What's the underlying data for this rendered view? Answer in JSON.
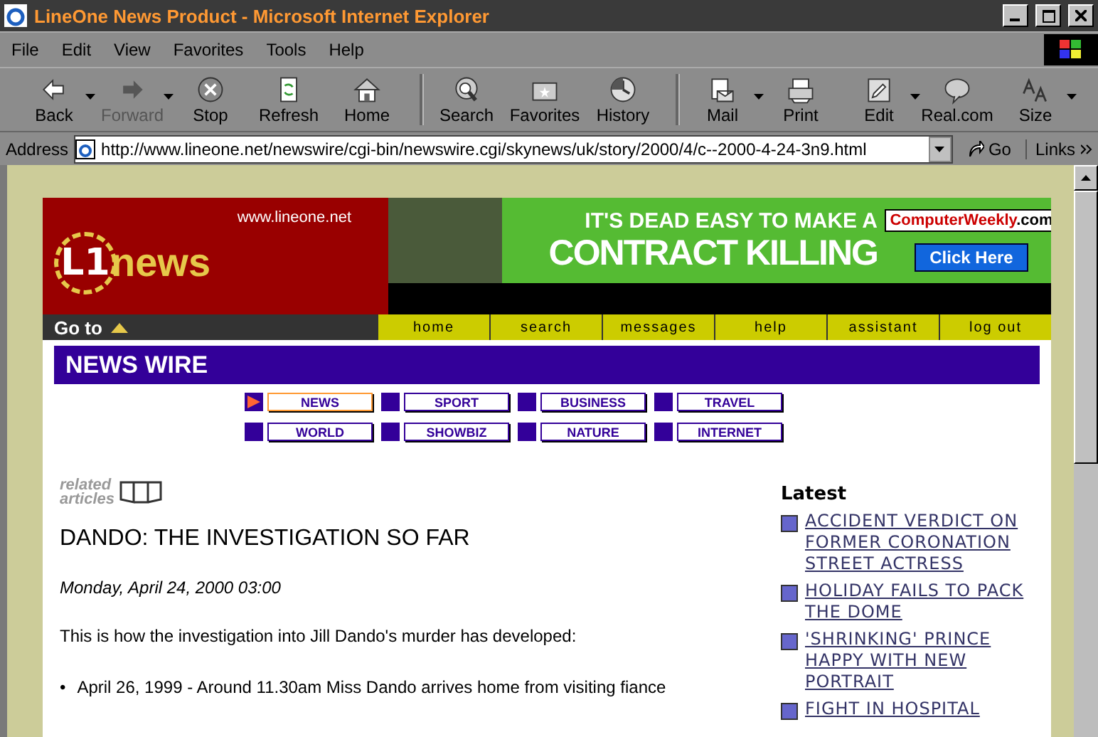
{
  "window": {
    "title": "LineOne News Product - Microsoft Internet Explorer"
  },
  "menu": [
    "File",
    "Edit",
    "View",
    "Favorites",
    "Tools",
    "Help"
  ],
  "toolbar": [
    {
      "label": "Back",
      "dropdown": true,
      "disabled": false
    },
    {
      "label": "Forward",
      "dropdown": true,
      "disabled": true
    },
    {
      "label": "Stop",
      "dropdown": false,
      "disabled": false
    },
    {
      "label": "Refresh",
      "dropdown": false,
      "disabled": false
    },
    {
      "label": "Home",
      "dropdown": false,
      "disabled": false
    },
    {
      "label": "Search",
      "dropdown": false,
      "disabled": false
    },
    {
      "label": "Favorites",
      "dropdown": false,
      "disabled": false
    },
    {
      "label": "History",
      "dropdown": false,
      "disabled": false
    },
    {
      "label": "Mail",
      "dropdown": true,
      "disabled": false
    },
    {
      "label": "Print",
      "dropdown": false,
      "disabled": false
    },
    {
      "label": "Edit",
      "dropdown": true,
      "disabled": false
    },
    {
      "label": "Real.com",
      "dropdown": false,
      "disabled": false
    },
    {
      "label": "Size",
      "dropdown": true,
      "disabled": false
    }
  ],
  "address_bar": {
    "label": "Address",
    "url": "http://www.lineone.net/newswire/cgi-bin/newswire.cgi/skynews/uk/story/2000/4/c--2000-4-24-3n9.html",
    "go": "Go",
    "links": "Links"
  },
  "header": {
    "site_url": "www.lineone.net",
    "logo_mark": "L1",
    "logo_word": "news",
    "goto": "Go to"
  },
  "ad": {
    "tagline": "IT'S DEAD EASY TO MAKE A",
    "headline": "CONTRACT KILLING",
    "brand": "ComputerWeekly",
    "brand_suffix": ".com",
    "cta": "Click Here"
  },
  "nav": [
    "home",
    "search",
    "messages",
    "help",
    "assistant",
    "log out"
  ],
  "section_title": "NEWS WIRE",
  "categories": [
    {
      "label": "NEWS",
      "selected": true
    },
    {
      "label": "SPORT",
      "selected": false
    },
    {
      "label": "BUSINESS",
      "selected": false
    },
    {
      "label": "TRAVEL",
      "selected": false
    },
    {
      "label": "WORLD",
      "selected": false
    },
    {
      "label": "SHOWBIZ",
      "selected": false
    },
    {
      "label": "NATURE",
      "selected": false
    },
    {
      "label": "INTERNET",
      "selected": false
    }
  ],
  "related": [
    "related",
    "articles"
  ],
  "article": {
    "headline": "DANDO: THE INVESTIGATION SO FAR",
    "date": "Monday, April 24, 2000 03:00",
    "intro": "This is how the investigation into Jill Dando's murder has developed:",
    "bullets": [
      {
        "marker": "•",
        "text": "April 26, 1999 - Around 11.30am Miss Dando arrives home from visiting fiance"
      }
    ]
  },
  "latest": {
    "title": "Latest",
    "items": [
      "ACCIDENT VERDICT ON FORMER CORONATION STREET ACTRESS",
      "HOLIDAY FAILS TO PACK THE DOME",
      "'SHRINKING' PRINCE HAPPY WITH NEW PORTRAIT",
      "FIGHT IN HOSPITAL"
    ]
  }
}
